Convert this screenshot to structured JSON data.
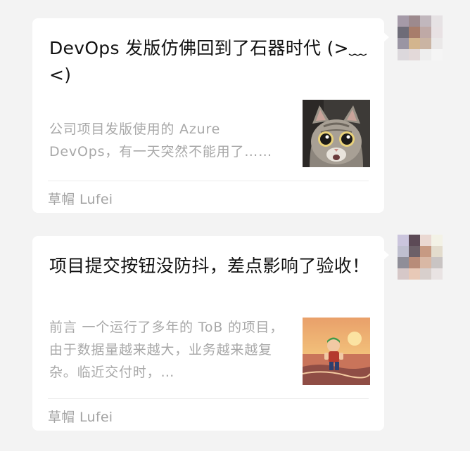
{
  "messages": [
    {
      "title": "DevOps 发版仿佛回到了石器时代 (>﹏<)",
      "description": "公司项目发版使用的 Azure DevOps，有一天突然不能用了……",
      "source": "草帽 Lufei",
      "thumbnail": "surprised-cat-icon",
      "avatar_colors": [
        "#a59aa8",
        "#9d8a8e",
        "#c1b7bd",
        "#e6e2e4",
        "#6e6c78",
        "#a87d6b",
        "#bfa9a6",
        "#e8e1e3",
        "#9a95a3",
        "#d3b58e",
        "#cab4a3",
        "#eae8e8",
        "#dcd8dc",
        "#e3d9d9",
        "#eeeeee",
        "#f5f5f5"
      ]
    },
    {
      "title": "项目提交按钮没防抖，差点影响了验收！",
      "description": "前言 一个运行了多年的 ToB 的项目，由于数据量越来越大，业务越来越复杂。临近交付时，…",
      "source": "草帽 Lufei",
      "thumbnail": "anime-boy-sunset-beach-icon",
      "avatar_colors": [
        "#cbc5dd",
        "#5c4a56",
        "#ead8d2",
        "#f3f2e6",
        "#bfbfcf",
        "#6c6068",
        "#c79a83",
        "#e3dccd",
        "#8f8e98",
        "#b88c79",
        "#d9b8a5",
        "#c9c4c3",
        "#d6c8c8",
        "#e8c9b7",
        "#d8cfcc",
        "#e9e3e3"
      ]
    }
  ]
}
